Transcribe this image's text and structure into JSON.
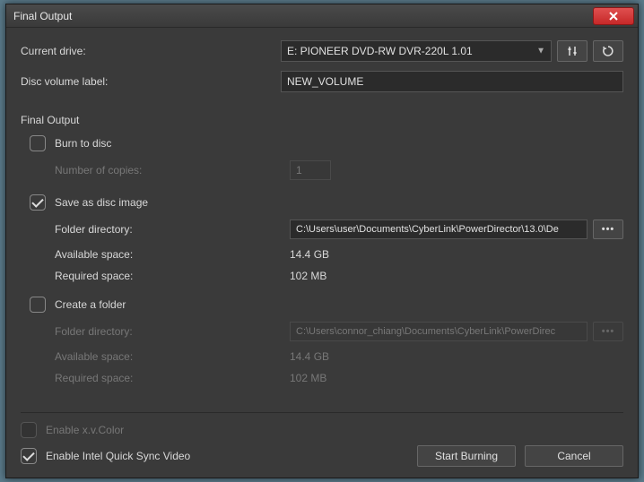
{
  "window": {
    "title": "Final Output"
  },
  "top": {
    "current_drive_label": "Current drive:",
    "current_drive_value": "E: PIONEER DVD-RW  DVR-220L 1.01",
    "disc_volume_label": "Disc volume label:",
    "disc_volume_value": "NEW_VOLUME"
  },
  "section_title": "Final Output",
  "burn": {
    "label": "Burn to disc",
    "checked": false,
    "copies_label": "Number of copies:",
    "copies_value": "1"
  },
  "save_image": {
    "label": "Save as disc image",
    "checked": true,
    "folder_label": "Folder directory:",
    "folder_value": "C:\\Users\\user\\Documents\\CyberLink\\PowerDirector\\13.0\\De",
    "avail_label": "Available space:",
    "avail_value": "14.4 GB",
    "req_label": "Required space:",
    "req_value": "102 MB"
  },
  "create_folder": {
    "label": "Create a folder",
    "checked": false,
    "folder_label": "Folder directory:",
    "folder_value": "C:\\Users\\connor_chiang\\Documents\\CyberLink\\PowerDirec",
    "avail_label": "Available space:",
    "avail_value": "14.4 GB",
    "req_label": "Required space:",
    "req_value": "102 MB"
  },
  "footer": {
    "xvcolor_label": "Enable x.v.Color",
    "xvcolor_checked": false,
    "qsv_label": "Enable Intel Quick Sync Video",
    "qsv_checked": true,
    "start_label": "Start Burning",
    "cancel_label": "Cancel"
  }
}
